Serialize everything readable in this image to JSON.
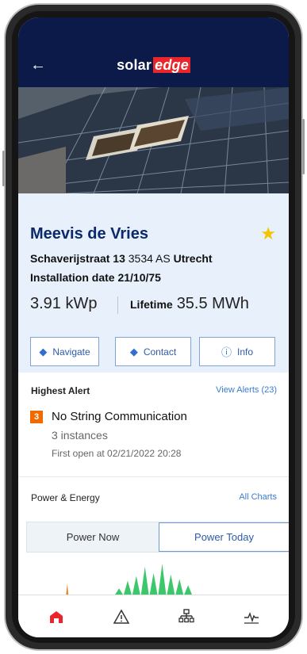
{
  "header": {
    "back_icon": "arrow-left-icon",
    "logo_part1": "solar",
    "logo_part2": "edge",
    "brand_color": "#e8262c",
    "bar_color": "#0b1a48"
  },
  "site": {
    "name": "Meevis de Vries",
    "address_street": "Schaverijstraat 13",
    "address_postal": "3534 AS",
    "address_city": "Utrecht",
    "installation_date": "Installation date 21/10/75",
    "peak_power": "3.91 kWp",
    "lifetime_label": "Lifetime",
    "lifetime_value": "35.5 MWh",
    "favorite_icon": "star-icon"
  },
  "actions": {
    "navigate": "Navigate",
    "contact": "Contact",
    "info": "Info"
  },
  "alerts": {
    "title": "Highest Alert",
    "view_link": "View Alerts (23)",
    "badge": "3",
    "alert_title": "No String Communication",
    "instances": "3 instances",
    "first_open": "First open at 02/21/2022 20:28"
  },
  "power": {
    "title": "Power & Energy",
    "all_charts": "All Charts",
    "tab_now": "Power Now",
    "tab_today": "Power Today",
    "selected_tab": "Power Today"
  },
  "chart_data": {
    "type": "area",
    "title": "",
    "series": [
      {
        "values": [
          0,
          0,
          0.35,
          0,
          0,
          0,
          0,
          0,
          0.2,
          0.45,
          0.6,
          0.9,
          0.7,
          1.0,
          0.65,
          0.5,
          0.3,
          0
        ]
      }
    ]
  },
  "nav": {
    "items": [
      "home-icon",
      "alert-icon",
      "layout-icon",
      "activity-icon"
    ],
    "active": "home-icon",
    "active_color": "#e8262c"
  }
}
